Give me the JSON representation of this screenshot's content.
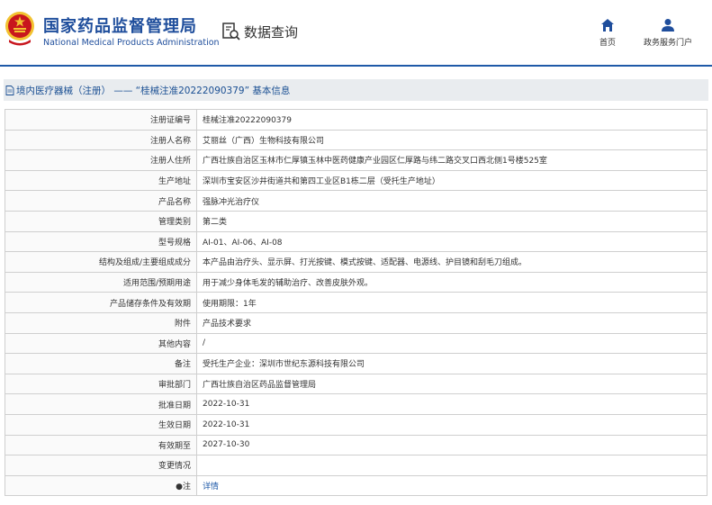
{
  "header": {
    "brand_cn": "国家药品监督管理局",
    "brand_en": "National Medical Products Administration",
    "data_query_label": "数据查询",
    "nav": [
      {
        "label": "首页",
        "icon": "home-icon"
      },
      {
        "label": "政务服务门户",
        "icon": "user-icon"
      }
    ]
  },
  "breadcrumb": {
    "title": "境内医疗器械（注册） —— “桂械注准20222090379” 基本信息"
  },
  "record": {
    "rows": [
      {
        "label": "注册证编号",
        "value": "桂械注准20222090379"
      },
      {
        "label": "注册人名称",
        "value": "艾丽丝（广西）生物科技有限公司"
      },
      {
        "label": "注册人住所",
        "value": "广西壮族自治区玉林市仁厚镇玉林中医药健康产业园区仁厚路与纬二路交叉口西北侧1号楼525室"
      },
      {
        "label": "生产地址",
        "value": "深圳市宝安区沙井街道共和第四工业区B1栋二层（受托生产地址）"
      },
      {
        "label": "产品名称",
        "value": "强脉冲光治疗仪"
      },
      {
        "label": "管理类别",
        "value": "第二类"
      },
      {
        "label": "型号规格",
        "value": "AI-01、AI-06、AI-08"
      },
      {
        "label": "结构及组成/主要组成成分",
        "value": "本产品由治疗头、显示屏、打光按键、模式按键、适配器、电源线、护目镜和刮毛刀组成。"
      },
      {
        "label": "适用范围/预期用途",
        "value": "用于减少身体毛发的辅助治疗、改善皮肤外观。"
      },
      {
        "label": "产品储存条件及有效期",
        "value": "使用期限：1年"
      },
      {
        "label": "附件",
        "value": "产品技术要求"
      },
      {
        "label": "其他内容",
        "value": "/"
      },
      {
        "label": "备注",
        "value": "受托生产企业：深圳市世纪东源科技有限公司"
      },
      {
        "label": "审批部门",
        "value": "广西壮族自治区药品监督管理局"
      },
      {
        "label": "批准日期",
        "value": "2022-10-31"
      },
      {
        "label": "生效日期",
        "value": "2022-10-31"
      },
      {
        "label": "有效期至",
        "value": "2027-10-30"
      },
      {
        "label": "变更情况",
        "value": ""
      }
    ],
    "note_label": "注",
    "note_link": "详情"
  },
  "colors": {
    "brand_blue": "#1f4e9c",
    "title_bar_bg": "#e9ecef",
    "emblem_red": "#c8161d",
    "emblem_gold": "#f2c230"
  }
}
